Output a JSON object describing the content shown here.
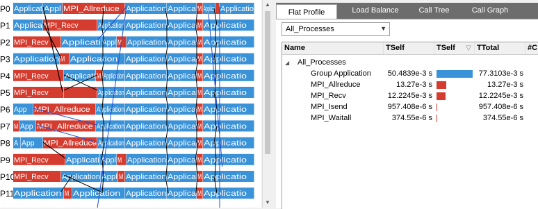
{
  "timeline": {
    "process_labels": [
      "P0",
      "P1",
      "P2",
      "P3",
      "P4",
      "P5",
      "P6",
      "P7",
      "P8",
      "P9",
      "P10",
      "P11"
    ],
    "colors": {
      "application": "#3a92d8",
      "mpi": "#d53c30",
      "message_line": "#000000",
      "collective_line": "#1f4fd0"
    },
    "visible_segment_texts": [
      "Applicat",
      "Appl",
      "MPI_Allreduce",
      "Application",
      "Applica",
      "Applicatio",
      "MPI_Recv",
      "Applicati",
      "App",
      "MPI_Allreduce",
      "MPI_Recv",
      "Application",
      "M",
      "A"
    ]
  },
  "tabs": [
    "Flat Profile",
    "Load Balance",
    "Call Tree",
    "Call Graph"
  ],
  "active_tab": "Flat Profile",
  "filter": {
    "selected": "All_Processes"
  },
  "table": {
    "columns": [
      "Name",
      "TSelf",
      "TSelf",
      "TTotal",
      "#C"
    ],
    "root": "All_Processes",
    "rows": [
      {
        "name": "Group Application",
        "tself": "50.4839e-3 s",
        "fraction": 1.0,
        "color": "#3a92d8",
        "ttotal": "77.3103e-3 s"
      },
      {
        "name": "MPI_Allreduce",
        "tself": "13.27e-3 s",
        "fraction": 0.263,
        "color": "#d53c30",
        "ttotal": "13.27e-3 s"
      },
      {
        "name": "MPI_Recv",
        "tself": "12.2245e-3 s",
        "fraction": 0.242,
        "color": "#d53c30",
        "ttotal": "12.2245e-3 s"
      },
      {
        "name": "MPI_Isend",
        "tself": "957.408e-6 s",
        "fraction": 0.019,
        "color": "#d53c30",
        "ttotal": "957.408e-6 s"
      },
      {
        "name": "MPI_Waitall",
        "tself": "374.55e-6 s",
        "fraction": 0.007,
        "color": "#d53c30",
        "ttotal": "374.55e-6 s"
      }
    ]
  }
}
